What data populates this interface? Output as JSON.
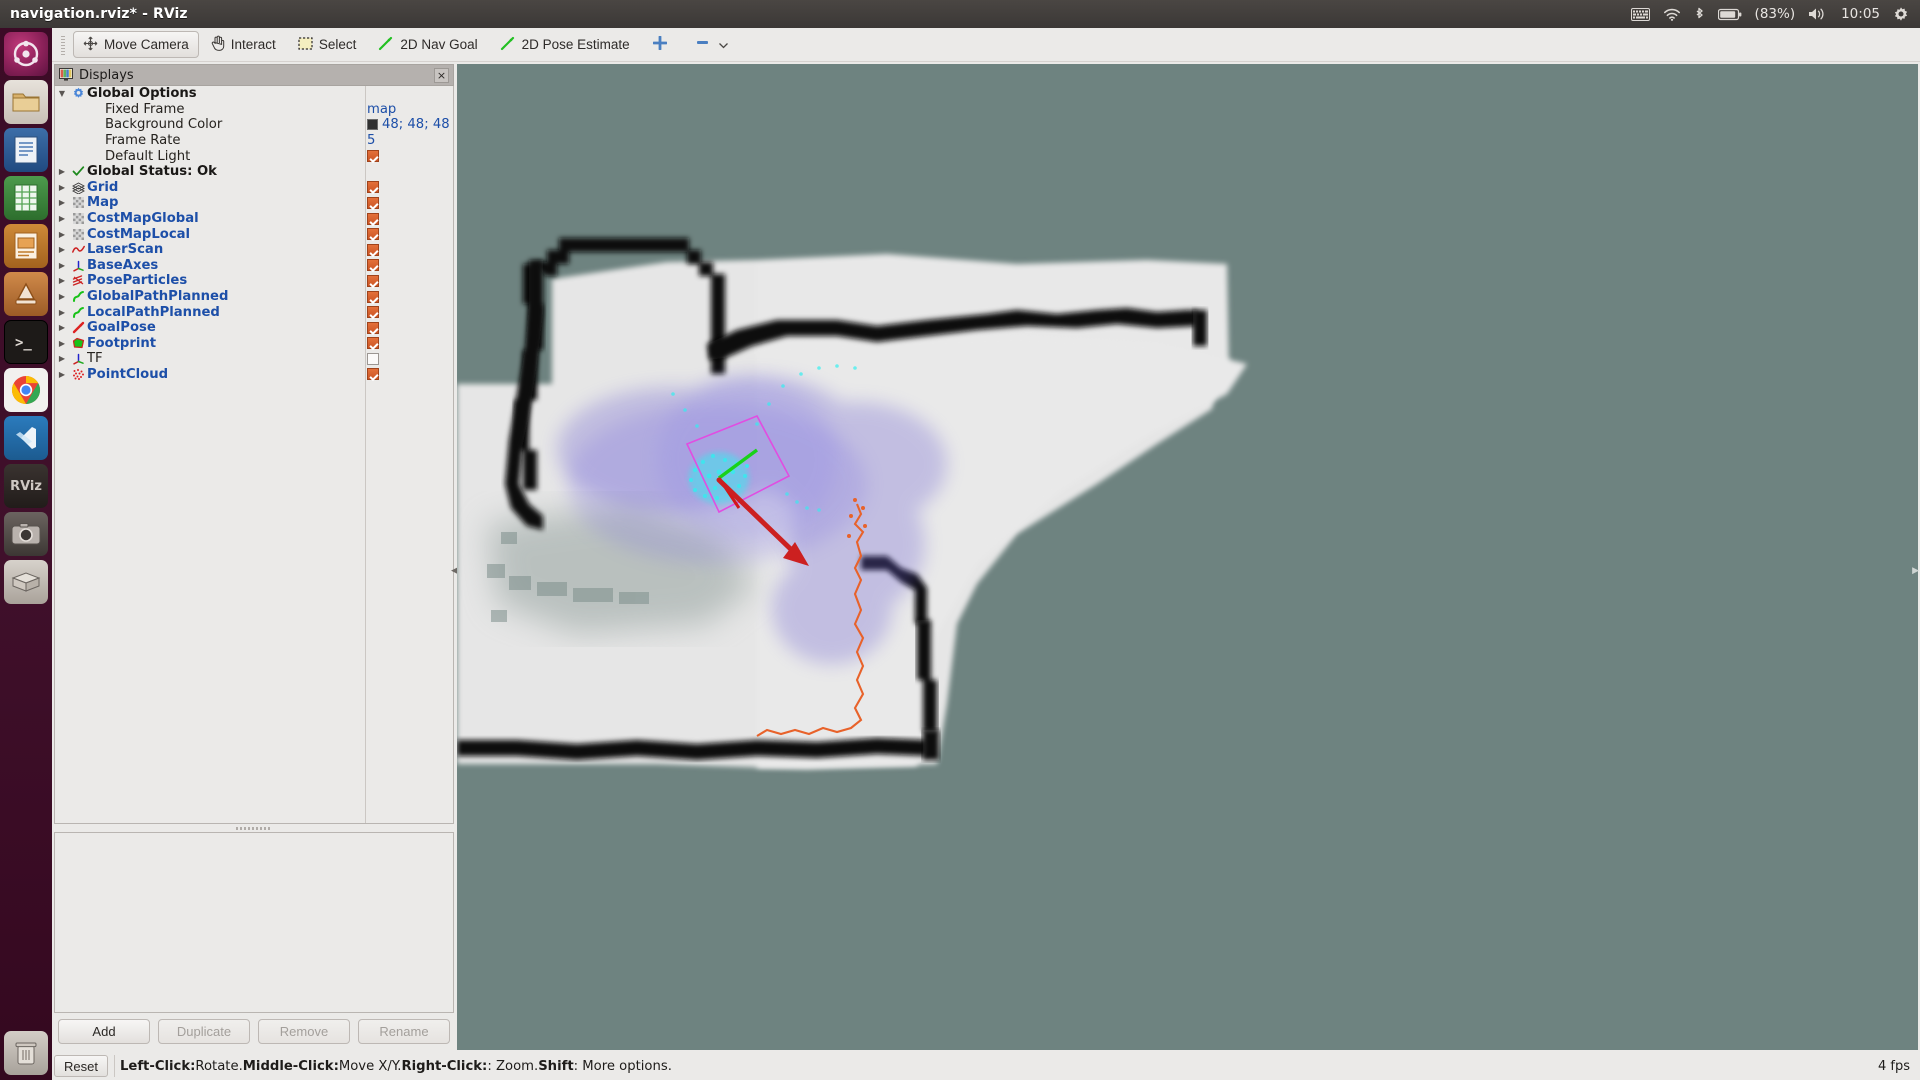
{
  "top_panel": {
    "window_title": "navigation.rviz* - RViz",
    "tray": {
      "keyboard_icon": "keyboard-layout-icon",
      "wifi_icon": "wifi-icon",
      "bluetooth_icon": "bluetooth-icon",
      "battery_icon": "battery-icon",
      "battery_label": "(83%)",
      "volume_icon": "volume-icon",
      "clock": "10:05",
      "system_icon": "system-menu-icon"
    }
  },
  "launcher": {
    "items": [
      {
        "name": "ubuntu-dash",
        "label": "",
        "class": "ubuntu"
      },
      {
        "name": "files",
        "label": "",
        "class": "files"
      },
      {
        "name": "libreoffice-writer",
        "label": "",
        "class": "writer"
      },
      {
        "name": "libreoffice-calc",
        "label": "",
        "class": "calc"
      },
      {
        "name": "libreoffice-impress",
        "label": "",
        "class": "impress"
      },
      {
        "name": "software-updater",
        "label": "",
        "class": "soft"
      },
      {
        "name": "terminal",
        "label": "",
        "class": "term"
      },
      {
        "name": "chrome",
        "label": "",
        "class": "chrome"
      },
      {
        "name": "vscode",
        "label": "",
        "class": "vscode"
      },
      {
        "name": "rviz",
        "label": "RViz",
        "class": "rviz"
      },
      {
        "name": "screenshot",
        "label": "",
        "class": "shot"
      },
      {
        "name": "archive-manager",
        "label": "",
        "class": "amazon"
      }
    ],
    "trash_label": ""
  },
  "toolbar": {
    "buttons": [
      {
        "name": "move-camera",
        "label": "Move Camera",
        "icon": "move-camera-icon",
        "active": true
      },
      {
        "name": "interact",
        "label": "Interact",
        "icon": "hand-icon",
        "active": false
      },
      {
        "name": "select",
        "label": "Select",
        "icon": "select-rect-icon",
        "active": false
      },
      {
        "name": "nav-goal",
        "label": "2D Nav Goal",
        "icon": "green-arrow-icon",
        "active": false
      },
      {
        "name": "pose-estimate",
        "label": "2D Pose Estimate",
        "icon": "green-arrow-icon",
        "active": false
      },
      {
        "name": "measure",
        "label": "",
        "icon": "move-cross-icon",
        "active": false
      },
      {
        "name": "focus-camera",
        "label": "",
        "icon": "focus-icon",
        "active": false
      }
    ]
  },
  "displays_panel": {
    "title": "Displays",
    "close_label": "×",
    "rows": [
      {
        "name": "global-options",
        "label": "Global Options",
        "style": "bold",
        "arrow": "down",
        "icon": "gear-icon",
        "indent": 0,
        "value_type": "none",
        "value": ""
      },
      {
        "name": "fixed-frame",
        "label": "Fixed Frame",
        "style": "plain",
        "arrow": "none",
        "icon": "none",
        "indent": 1,
        "value_type": "text",
        "value": "map"
      },
      {
        "name": "background-color",
        "label": "Background Color",
        "style": "plain",
        "arrow": "none",
        "icon": "none",
        "indent": 1,
        "value_type": "color",
        "value": "48; 48; 48",
        "color": "#303030"
      },
      {
        "name": "frame-rate",
        "label": "Frame Rate",
        "style": "plain",
        "arrow": "none",
        "icon": "none",
        "indent": 1,
        "value_type": "text",
        "value": "5"
      },
      {
        "name": "default-light",
        "label": "Default Light",
        "style": "plain",
        "arrow": "none",
        "icon": "none",
        "indent": 1,
        "value_type": "check",
        "value": "checked"
      },
      {
        "name": "global-status",
        "label": "Global Status: Ok",
        "style": "bold",
        "arrow": "right",
        "icon": "check-icon",
        "indent": 0,
        "value_type": "none",
        "value": ""
      },
      {
        "name": "grid",
        "label": "Grid",
        "style": "blue",
        "arrow": "right",
        "icon": "grid-icon",
        "indent": 0,
        "value_type": "check",
        "value": "checked"
      },
      {
        "name": "map",
        "label": "Map",
        "style": "blue",
        "arrow": "right",
        "icon": "map-icon",
        "indent": 0,
        "value_type": "check",
        "value": "checked"
      },
      {
        "name": "costmap-global",
        "label": "CostMapGlobal",
        "style": "blue",
        "arrow": "right",
        "icon": "map-icon",
        "indent": 0,
        "value_type": "check",
        "value": "checked"
      },
      {
        "name": "costmap-local",
        "label": "CostMapLocal",
        "style": "blue",
        "arrow": "right",
        "icon": "map-icon",
        "indent": 0,
        "value_type": "check",
        "value": "checked"
      },
      {
        "name": "laser-scan",
        "label": "LaserScan",
        "style": "blue",
        "arrow": "right",
        "icon": "laserscan-icon",
        "indent": 0,
        "value_type": "check",
        "value": "checked"
      },
      {
        "name": "base-axes",
        "label": "BaseAxes",
        "style": "blue",
        "arrow": "right",
        "icon": "axes-icon",
        "indent": 0,
        "value_type": "check",
        "value": "checked"
      },
      {
        "name": "pose-particles",
        "label": "PoseParticles",
        "style": "blue",
        "arrow": "right",
        "icon": "posearray-icon",
        "indent": 0,
        "value_type": "check",
        "value": "checked"
      },
      {
        "name": "global-path-planned",
        "label": "GlobalPathPlanned",
        "style": "blue",
        "arrow": "right",
        "icon": "path-icon",
        "indent": 0,
        "value_type": "check",
        "value": "checked"
      },
      {
        "name": "local-path-planned",
        "label": "LocalPathPlanned",
        "style": "blue",
        "arrow": "right",
        "icon": "path-icon",
        "indent": 0,
        "value_type": "check",
        "value": "checked"
      },
      {
        "name": "goal-pose",
        "label": "GoalPose",
        "style": "blue",
        "arrow": "right",
        "icon": "pose-icon",
        "indent": 0,
        "value_type": "check",
        "value": "checked"
      },
      {
        "name": "footprint",
        "label": "Footprint",
        "style": "blue",
        "arrow": "right",
        "icon": "polygon-icon",
        "indent": 0,
        "value_type": "check",
        "value": "checked"
      },
      {
        "name": "tf",
        "label": "TF",
        "style": "plain",
        "arrow": "right",
        "icon": "axes-icon",
        "indent": 0,
        "value_type": "check",
        "value": "unchecked"
      },
      {
        "name": "point-cloud",
        "label": "PointCloud",
        "style": "blue",
        "arrow": "right",
        "icon": "pointcloud-icon",
        "indent": 0,
        "value_type": "check",
        "value": "checked"
      }
    ],
    "buttons": [
      {
        "name": "add-button",
        "label": "Add",
        "disabled": false
      },
      {
        "name": "duplicate-button",
        "label": "Duplicate",
        "disabled": true
      },
      {
        "name": "remove-button",
        "label": "Remove",
        "disabled": true
      },
      {
        "name": "rename-button",
        "label": "Rename",
        "disabled": true
      }
    ]
  },
  "statusbar": {
    "reset_label": "Reset",
    "hint_segments": [
      {
        "bold": "Left-Click:",
        "text": " Rotate. "
      },
      {
        "bold": "Middle-Click:",
        "text": " Move X/Y. "
      },
      {
        "bold": "Right-Click:",
        "text": ": Zoom. "
      },
      {
        "bold": "Shift",
        "text": ": More options."
      }
    ],
    "fps": "4 fps"
  },
  "view3d": {
    "background_color": "#6e8380",
    "collapse_left_icon": "chevron-left-icon",
    "collapse_right_icon": "chevron-right-icon"
  }
}
